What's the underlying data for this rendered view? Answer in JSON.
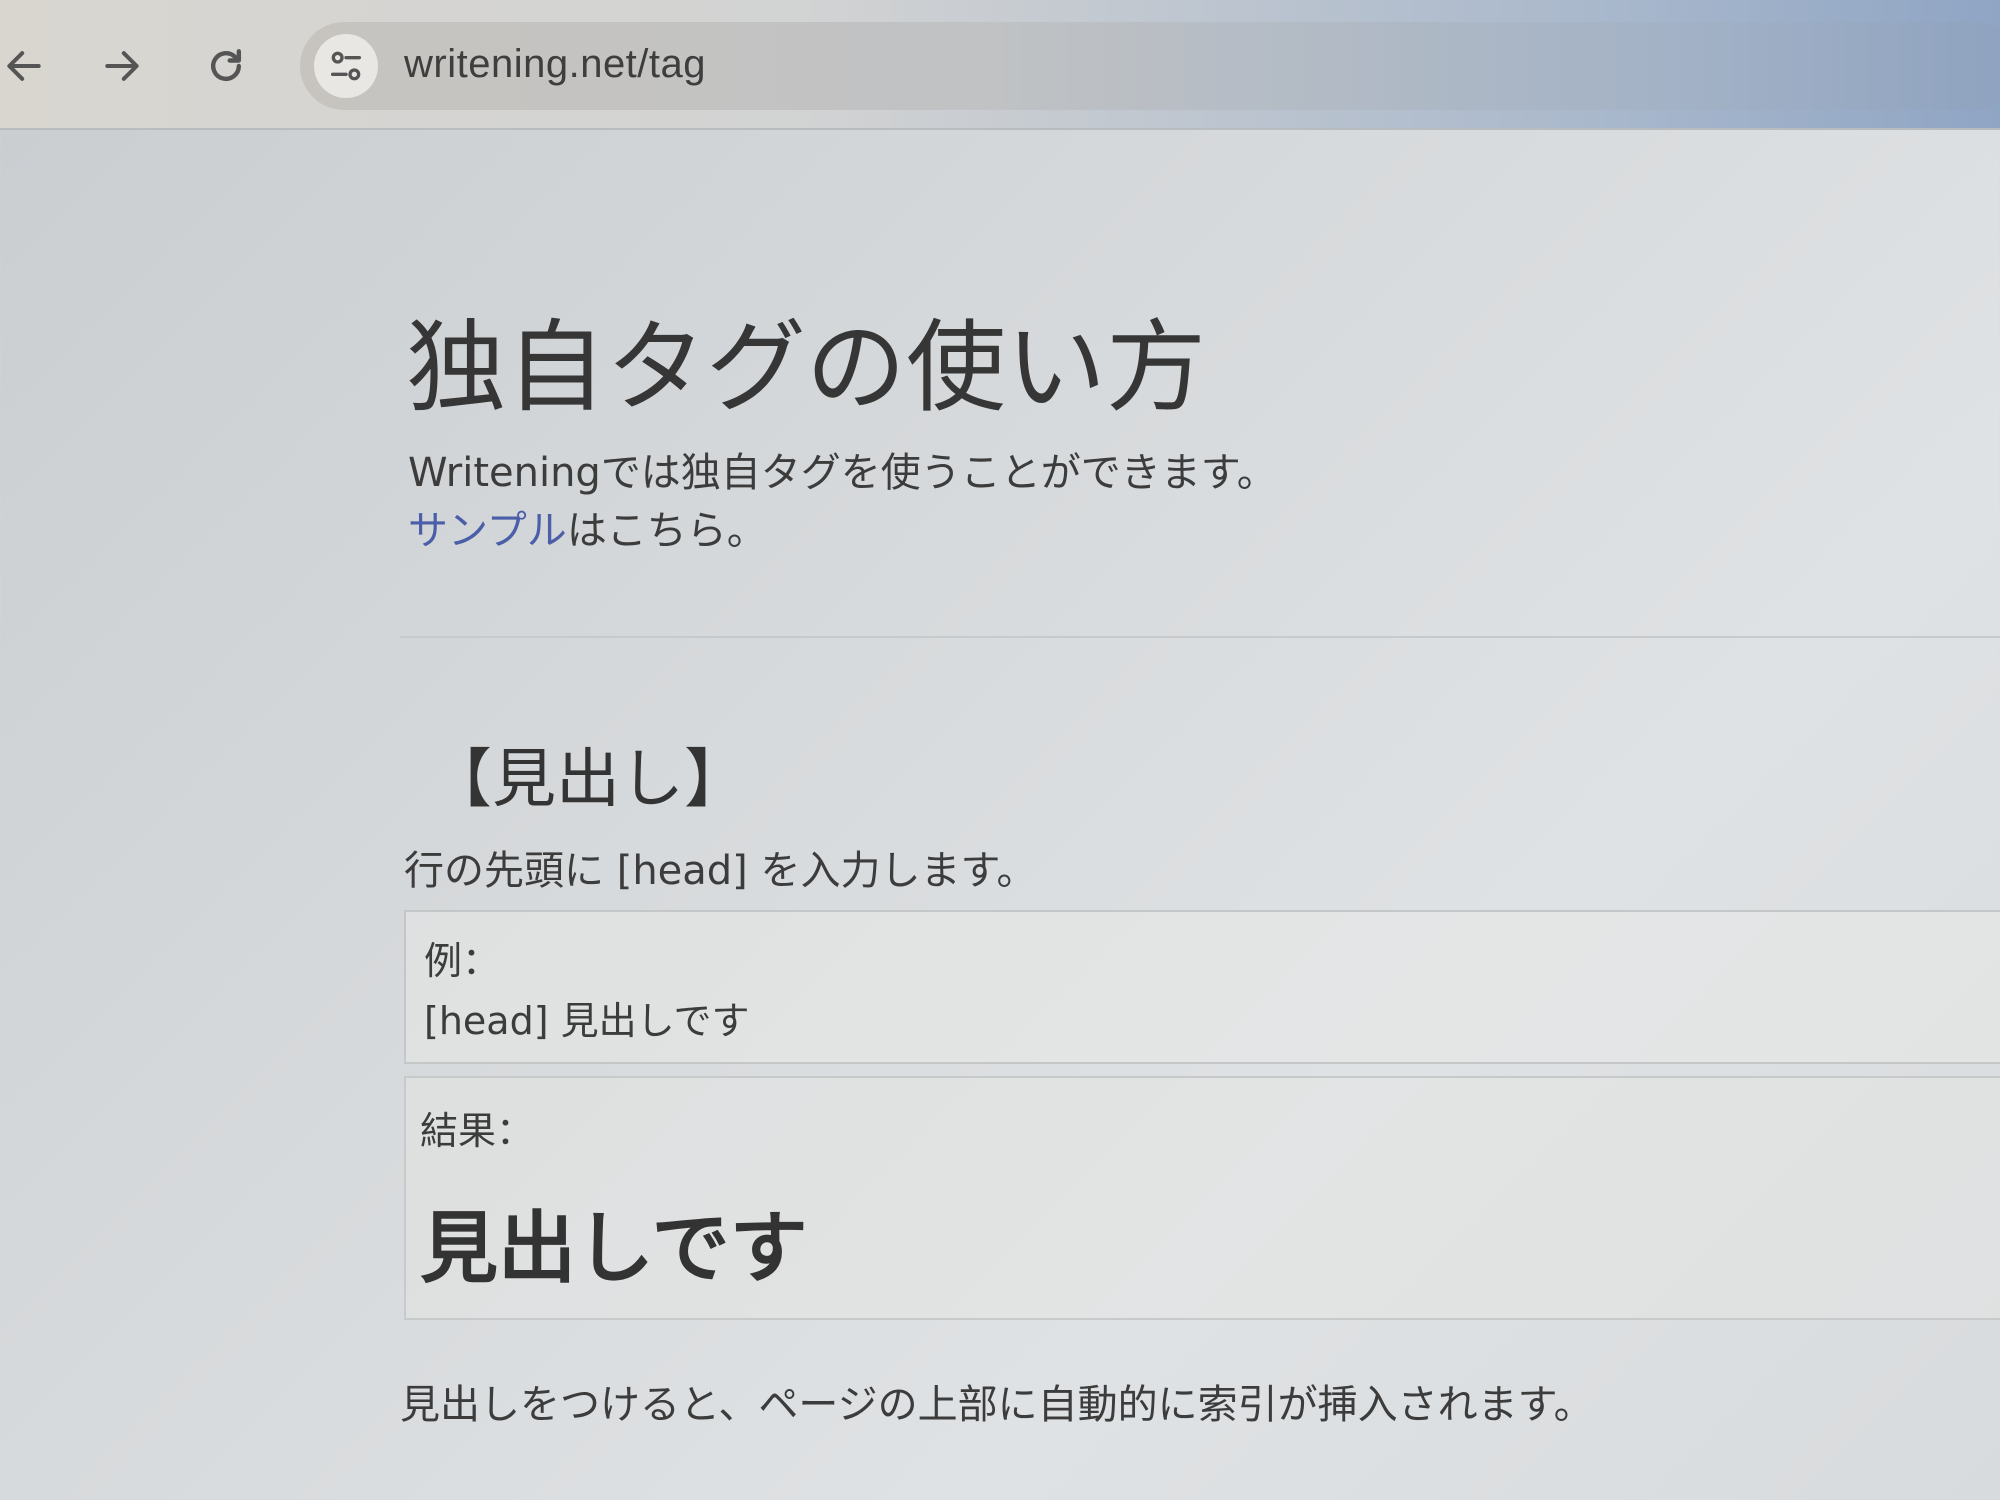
{
  "browser": {
    "url": "writening.net/tag",
    "icons": {
      "back": "arrow-left-icon",
      "forward": "arrow-right-icon",
      "reload": "reload-icon",
      "site_info": "tune-icon"
    }
  },
  "page": {
    "title": "独自タグの使い方",
    "intro_line1": "Writeningでは独自タグを使うことができます。",
    "sample_link": "サンプル",
    "intro_line2_rest": "はこちら。",
    "section_heading": "【見出し】",
    "instruction": "行の先頭に [head] を入力します。",
    "example": {
      "label": "例：",
      "code": "[head] 見出しです"
    },
    "result": {
      "label": "結果：",
      "heading": "見出しです"
    },
    "footer_note": "見出しをつけると、ページの上部に自動的に索引が挿入されます。"
  },
  "colors": {
    "link": "#4a5fa8",
    "text": "#3c3c3c"
  }
}
